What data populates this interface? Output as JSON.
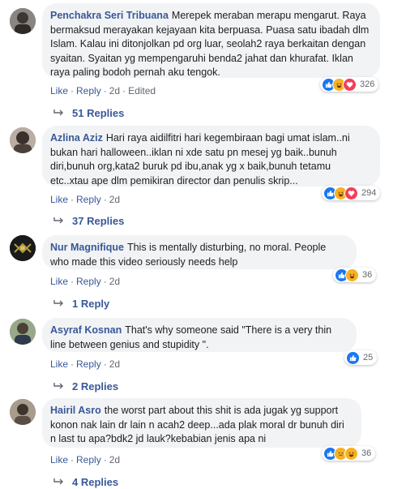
{
  "comments": [
    {
      "author": "Penchakra Seri Tribuana",
      "text": "Merepek meraban merapu mengarut. Raya bermaksud merayakan kejayaan kita berpuasa. Puasa satu ibadah dlm Islam. Kalau ini ditonjolkan pd org luar, seolah2 raya berkaitan dengan syaitan. Syaitan yg mempengaruhi benda2 jahat dan khurafat. Iklan raya paling bodoh pernah aku tengok.",
      "reaction_count": "326",
      "reactions": [
        "like-reaction-icon",
        "haha-reaction-icon",
        "love-reaction-icon"
      ],
      "like_label": "Like",
      "reply_label": "Reply",
      "time": "2d",
      "edited": "Edited",
      "replies_label": "51 Replies"
    },
    {
      "author": "Azlina Aziz",
      "text": "Hari raya aidilfitri hari kegembiraan bagi umat islam..ni bukan hari halloween..iklan ni xde satu pn mesej yg baik..bunuh diri,bunuh org,kata2 buruk pd ibu,anak yg x baik,bunuh tetamu etc..xtau ape dlm pemikiran director dan penulis skrip...",
      "reaction_count": "294",
      "reactions": [
        "like-reaction-icon",
        "haha-reaction-icon",
        "love-reaction-icon"
      ],
      "like_label": "Like",
      "reply_label": "Reply",
      "time": "2d",
      "replies_label": "37 Replies"
    },
    {
      "author": "Nur Magnifique",
      "text": "This is mentally disturbing, no moral. People who made this video seriously needs help",
      "reaction_count": "36",
      "reactions": [
        "like-reaction-icon",
        "haha-reaction-icon"
      ],
      "like_label": "Like",
      "reply_label": "Reply",
      "time": "2d",
      "replies_label": "1 Reply"
    },
    {
      "author": "Asyraf Kosnan",
      "text": "That's why someone said \"There is a very thin line between genius and stupidity \".",
      "reaction_count": "25",
      "reactions": [
        "like-reaction-icon"
      ],
      "like_label": "Like",
      "reply_label": "Reply",
      "time": "2d",
      "replies_label": "2 Replies"
    },
    {
      "author": "Hairil Asro",
      "text": "the worst part about this shit is ada jugak yg support konon nak lain dr lain n acah2 deep...ada plak moral dr bunuh diri n last tu apa?bdk2 jd lauk?kebabian jenis apa ni",
      "reaction_count": "36",
      "reactions": [
        "like-reaction-icon",
        "sad-reaction-icon",
        "haha-reaction-icon"
      ],
      "like_label": "Like",
      "reply_label": "Reply",
      "time": "2d",
      "replies_label": "4 Replies"
    }
  ],
  "colors": {
    "link": "#385898",
    "bubble": "#f2f3f5",
    "meta": "#606770",
    "like": "#1877f2",
    "love": "#f33e58",
    "haha": "#f7b125"
  }
}
